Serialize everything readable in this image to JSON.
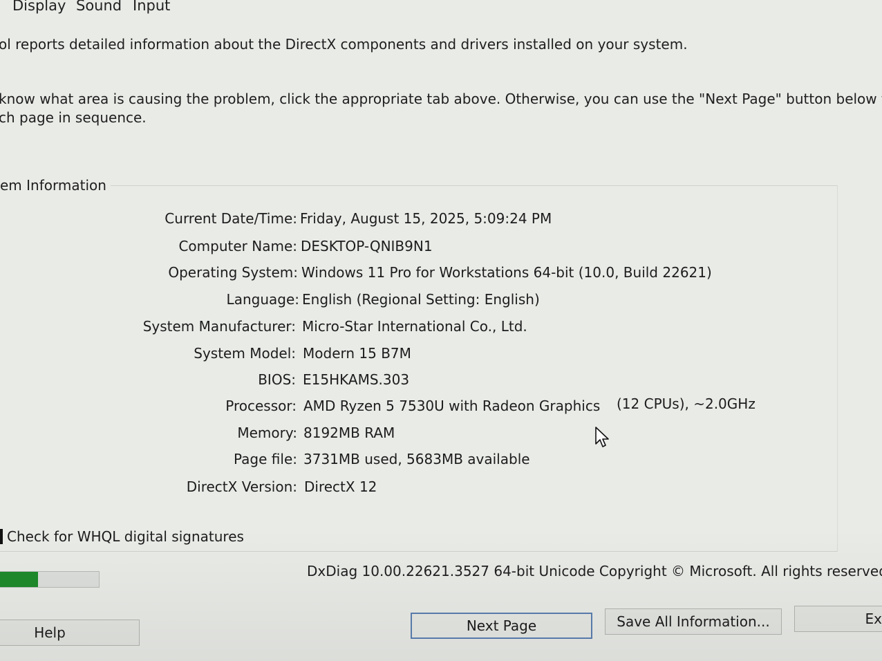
{
  "tabs": [
    "Display",
    "Sound",
    "Input"
  ],
  "intro": {
    "line1": "ol reports detailed information about the DirectX components and drivers installed on your system.",
    "line2": "know what area is causing the problem, click the appropriate tab above.  Otherwise, you can use the \"Next Page\" button below to",
    "line3": "ch page in sequence."
  },
  "system_info": {
    "group_title": "em Information",
    "rows": [
      {
        "label": "Current Date/Time:",
        "value": "Friday, August 15, 2025, 5:09:24 PM"
      },
      {
        "label": "Computer Name:",
        "value": "DESKTOP-QNIB9N1"
      },
      {
        "label": "Operating System:",
        "value": "Windows 11 Pro for Workstations 64-bit (10.0, Build 22621)"
      },
      {
        "label": "Language:",
        "value": "English (Regional Setting: English)"
      },
      {
        "label": "System Manufacturer:",
        "value": "Micro-Star International Co., Ltd."
      },
      {
        "label": "System Model:",
        "value": "Modern 15 B7M"
      },
      {
        "label": "BIOS:",
        "value": "E15HKAMS.303"
      },
      {
        "label": "Processor:",
        "value": "AMD Ryzen 5 7530U with Radeon Graphics"
      },
      {
        "label": "Memory:",
        "value": "8192MB RAM"
      },
      {
        "label": "Page file:",
        "value": "3731MB used, 5683MB available"
      },
      {
        "label": "DirectX Version:",
        "value": "DirectX 12"
      }
    ],
    "processor_extra": "(12 CPUs), ~2.0GHz"
  },
  "whql_label": "Check for WHQL digital signatures",
  "progress": 0.4,
  "footer_text": "DxDiag 10.00.22621.3527 64-bit Unicode  Copyright © Microsoft. All rights reserved.",
  "buttons": {
    "help": "Help",
    "next_page": "Next Page",
    "save_all": "Save All Information...",
    "exit": "Ex"
  },
  "colors": {
    "background": "#e9ebe7",
    "progress_fill": "#1e8a2a",
    "primary_button_border": "#5a7fb0"
  },
  "icons": {
    "cursor": "mouse-pointer-icon"
  }
}
